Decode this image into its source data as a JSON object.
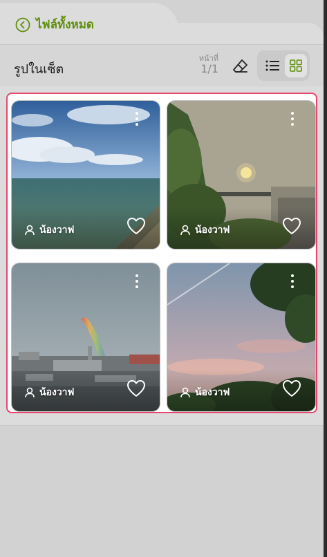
{
  "header": {
    "back_label": "ไฟล์ทั้งหมด",
    "back_icon": "chevron-left-circle-icon"
  },
  "toolbar": {
    "title": "รูปในเซ็ต",
    "page_label": "หน้าที่",
    "page_value": "1/1",
    "edit_icon": "eraser-icon",
    "view_modes": [
      "list",
      "grid"
    ],
    "active_view": "grid"
  },
  "photos": [
    {
      "owner": "น้องวาฟ",
      "scene": "sea and cloudy sky",
      "favorited": false
    },
    {
      "owner": "น้องวาฟ",
      "scene": "hazy sun over trees and rooftop",
      "favorited": false
    },
    {
      "owner": "น้องวาฟ",
      "scene": "rainbow over city skyline",
      "favorited": false
    },
    {
      "owner": "น้องวาฟ",
      "scene": "pink evening sky with trees",
      "favorited": false
    }
  ],
  "colors": {
    "accent_green": "#5e8f0b",
    "selection_border": "#e8466e",
    "background": "#d2d2d2"
  }
}
